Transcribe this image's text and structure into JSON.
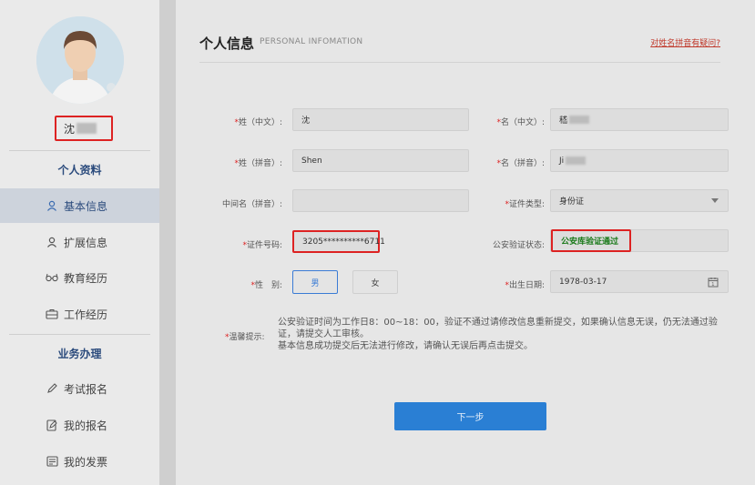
{
  "sidebar": {
    "user_name": "沈",
    "sections": [
      {
        "title": "个人资料"
      },
      {
        "title": "业务办理"
      }
    ],
    "items": [
      {
        "label": "基本信息",
        "icon": "user-icon"
      },
      {
        "label": "扩展信息",
        "icon": "user-icon"
      },
      {
        "label": "教育经历",
        "icon": "glasses-icon"
      },
      {
        "label": "工作经历",
        "icon": "briefcase-icon"
      },
      {
        "label": "考试报名",
        "icon": "pencil-icon"
      },
      {
        "label": "我的报名",
        "icon": "edit-document-icon"
      },
      {
        "label": "我的发票",
        "icon": "invoice-icon"
      }
    ]
  },
  "header": {
    "title": "个人信息",
    "subtitle": "PERSONAL INFOMATION",
    "help_link": "对姓名拼音有疑问?"
  },
  "form": {
    "surname_cn": {
      "label": "*姓（中文）:",
      "value": "沈"
    },
    "given_cn": {
      "label": "*名（中文）:",
      "value": "嵇"
    },
    "surname_py": {
      "label": "*姓（拼音）:",
      "value": "Shen"
    },
    "given_py": {
      "label": "*名（拼音）:",
      "value": "Ji"
    },
    "middle_name": {
      "label": "中间名（拼音）:",
      "value": ""
    },
    "id_type": {
      "label": "*证件类型:",
      "value": "身份证"
    },
    "id_number": {
      "label": "*证件号码:",
      "value": "3205**********6711"
    },
    "verify_status": {
      "label": "公安验证状态:",
      "value": "公安库验证通过"
    },
    "gender": {
      "label": "*性　别:",
      "male": "男",
      "female": "女",
      "selected": "男"
    },
    "birth_date": {
      "label": "*出生日期:",
      "value": "1978-03-17"
    }
  },
  "notice": {
    "label": "*温馨提示:",
    "lines": [
      "公安验证时间为工作日8：00~18：00，验证不通过请修改信息重新提交，如果确认信息无误，仍无法通过验证，请提交人工审核。",
      "基本信息成功提交后无法进行修改，请确认无误后再点击提交。"
    ]
  },
  "actions": {
    "next_label": "下一步"
  },
  "colors": {
    "accent": "#2a7fd4",
    "highlight": "#dd2222",
    "verified": "#1a7a1a"
  }
}
